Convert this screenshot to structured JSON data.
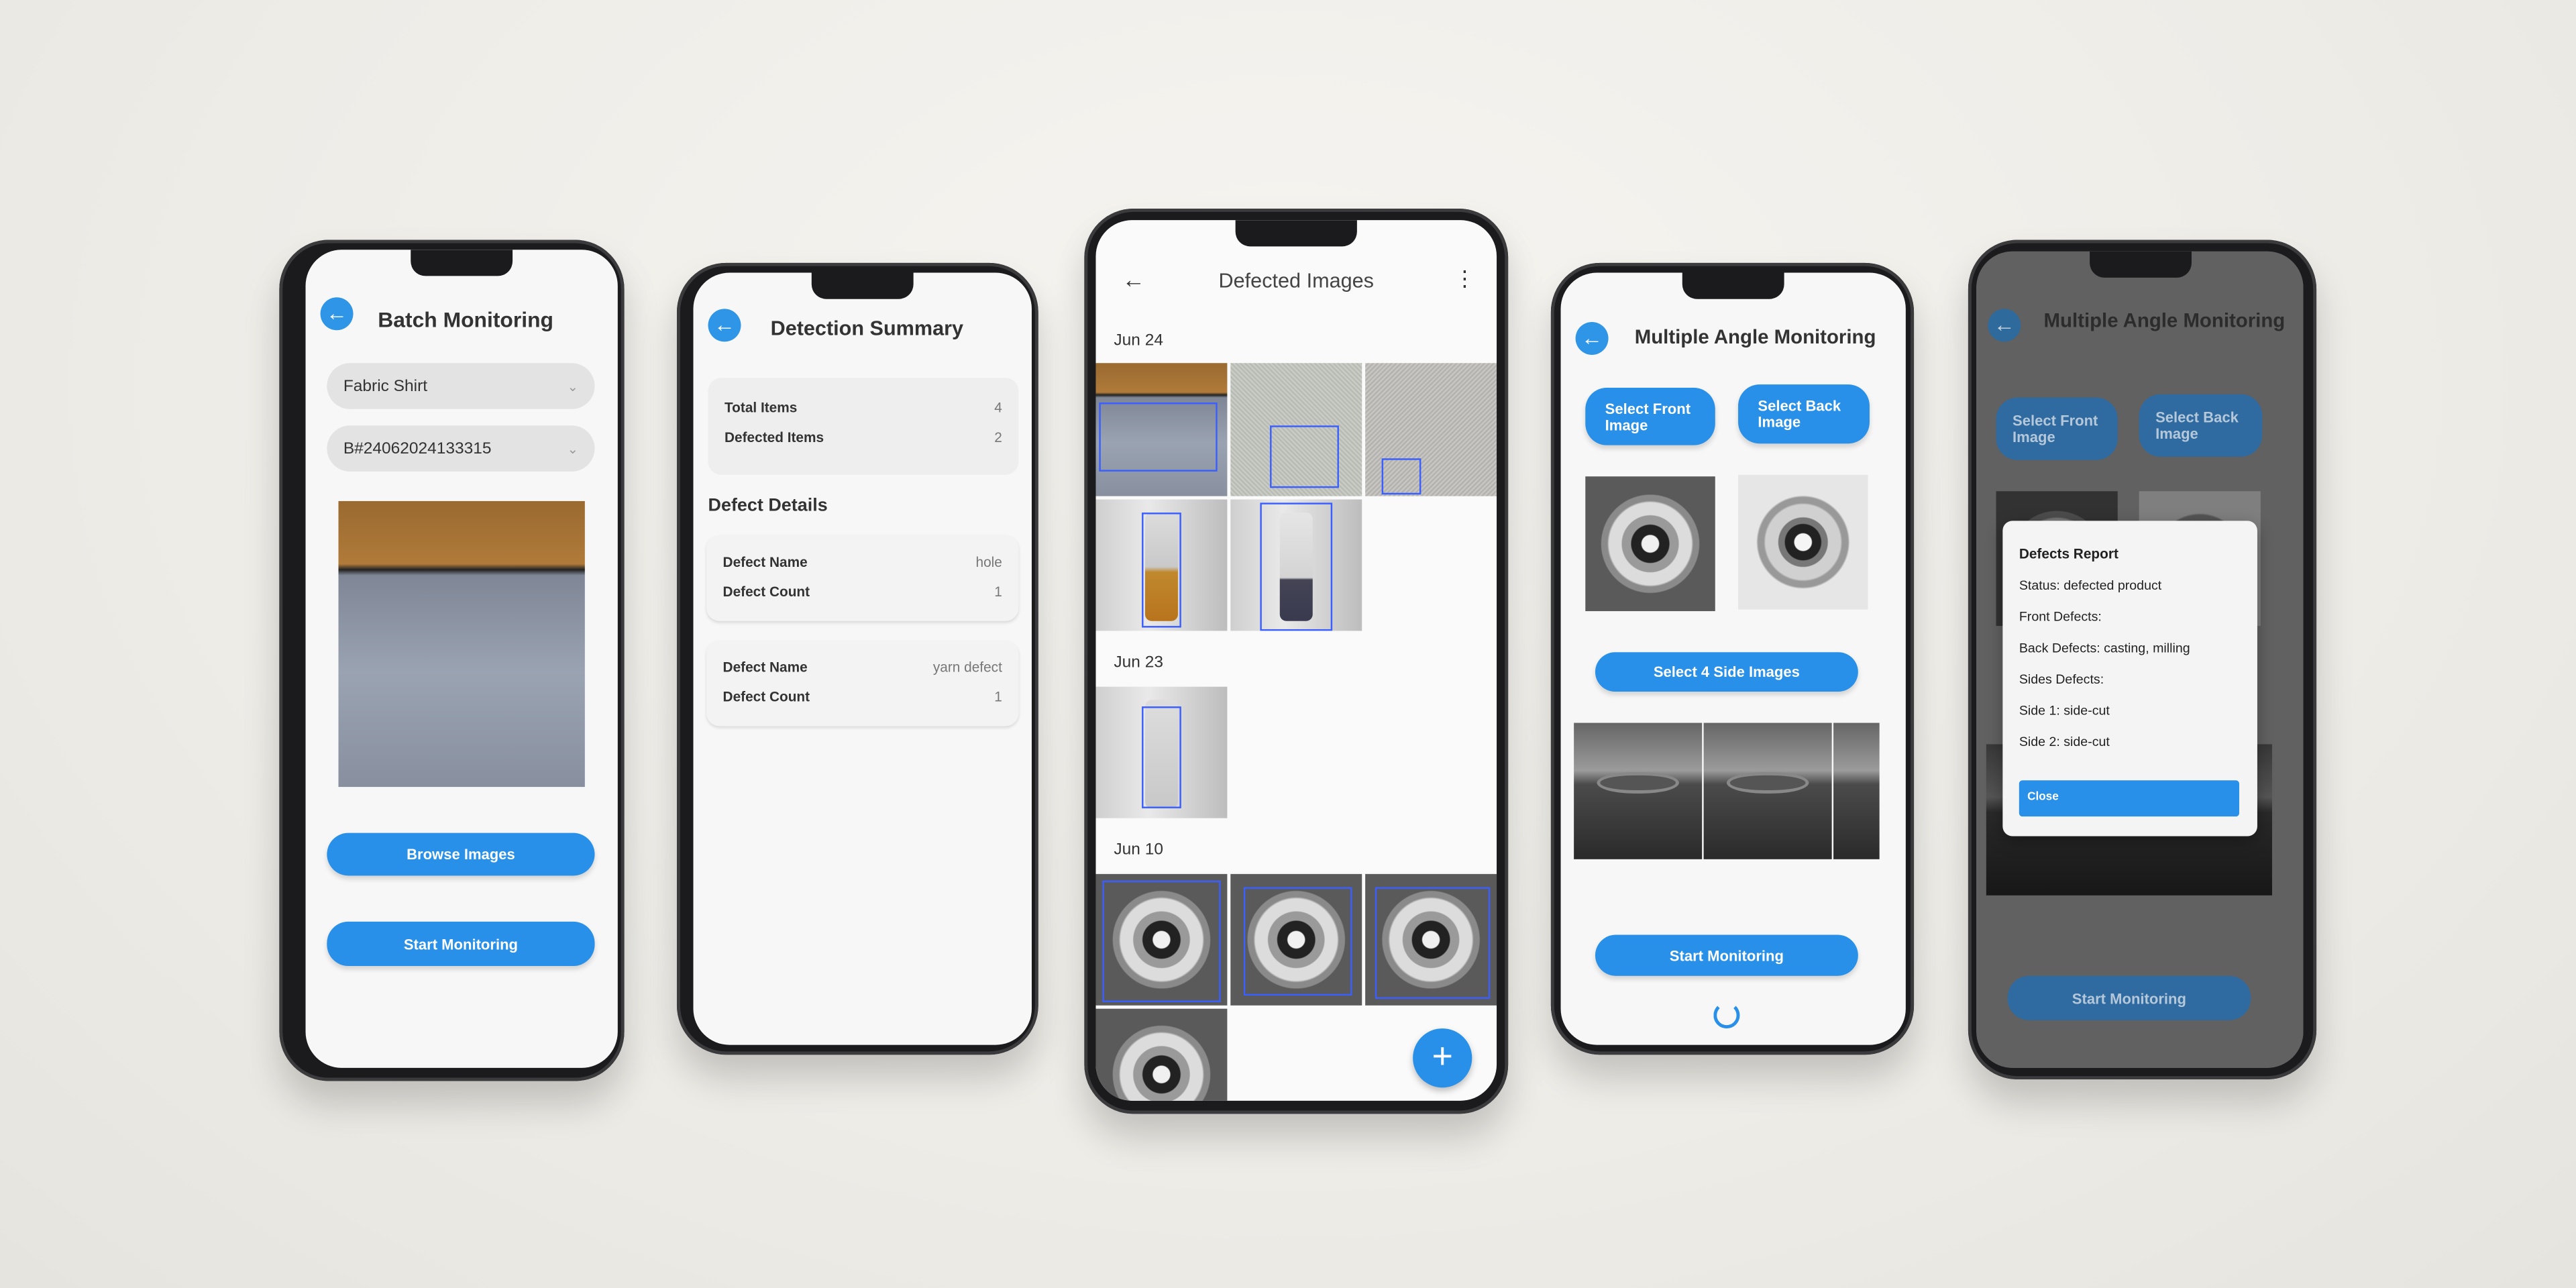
{
  "colors": {
    "accent": "#2890e8",
    "background": "#efede8",
    "screen": "#f7f7f7"
  },
  "batch": {
    "title": "Batch Monitoring",
    "back_icon": "arrow-left-icon",
    "product_select": "Fabric Shirt",
    "batch_select": "B#24062024133315",
    "browse_label": "Browse Images",
    "start_label": "Start Monitoring"
  },
  "summary": {
    "title": "Detection Summary",
    "totals": [
      {
        "label": "Total Items",
        "value": "4"
      },
      {
        "label": "Defected Items",
        "value": "2"
      }
    ],
    "details_heading": "Defect Details",
    "defects": [
      {
        "name_label": "Defect Name",
        "name": "hole",
        "count_label": "Defect Count",
        "count": "1"
      },
      {
        "name_label": "Defect Name",
        "name": "yarn defect",
        "count_label": "Defect Count",
        "count": "1"
      }
    ]
  },
  "gallery": {
    "title": "Defected Images",
    "back_icon": "arrow-left-icon",
    "menu_icon": "more-vertical-icon",
    "fab_icon": "plus-icon",
    "groups": [
      "Jun 24",
      "Jun 23",
      "Jun 10"
    ]
  },
  "multi": {
    "title": "Multiple Angle Monitoring",
    "front_label": "Select Front Image",
    "back_label": "Select Back Image",
    "sides_label": "Select 4 Side Images",
    "start_label": "Start Monitoring",
    "spinner_icon": "loading-spinner-icon"
  },
  "report": {
    "page_title": "Multiple Angle Monitoring",
    "front_label": "Select Front Image",
    "back_label": "Select Back Image",
    "start_label": "Start Monitoring",
    "dialog": {
      "title": "Defects Report",
      "lines": [
        "Status: defected product",
        "Front Defects:",
        "Back Defects: casting, milling",
        "Sides Defects:",
        "Side 1: side-cut",
        "Side 2: side-cut"
      ],
      "close_label": "Close"
    }
  }
}
